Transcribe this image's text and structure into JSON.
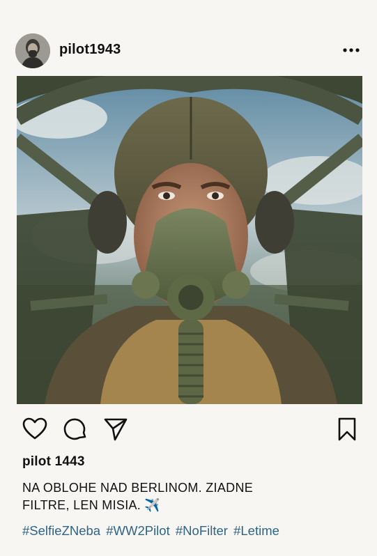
{
  "post": {
    "username": "pilot1943",
    "likes_user": "pilot 1443",
    "caption": "NA OBLOHE NAD BERLINOM. ZIADNE FILTRE, LEN MISIA.",
    "caption_emoji": "✈️",
    "hashtags": [
      "#SelfieZNeba",
      "#WW2Pilot",
      "#NoFilter",
      "#Letime"
    ]
  },
  "icons": {
    "avatar": "avatar-pilot",
    "more": "more-dots-icon",
    "like": "heart-icon",
    "comment": "comment-icon",
    "share": "send-icon",
    "save": "bookmark-icon"
  },
  "colors": {
    "background": "#f8f6f2",
    "hashtag": "#2e6487",
    "text": "#111111"
  }
}
